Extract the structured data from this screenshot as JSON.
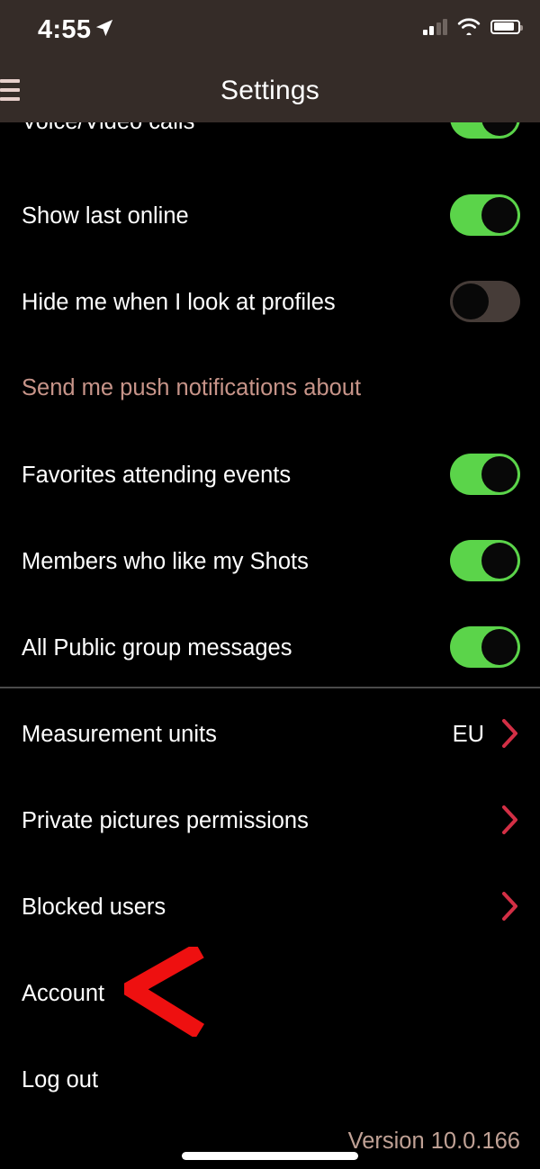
{
  "status_bar": {
    "time": "4:55",
    "location_icon": "location-arrow-icon",
    "cellular_icon": "cellular-signal-icon",
    "wifi_icon": "wifi-icon",
    "battery_icon": "battery-icon"
  },
  "nav": {
    "title": "Settings",
    "menu_icon": "hamburger-menu-icon",
    "logo_icon": "app-logo-hexagons-icon"
  },
  "colors": {
    "header_bg": "#352C28",
    "page_bg": "#000000",
    "toggle_on": "#5BD44A",
    "toggle_off": "#463C38",
    "chevron": "#D32F45",
    "section_header_text": "#C79489",
    "version_text": "#C0A195",
    "annotation_red": "#EE1010"
  },
  "privacy_section": {
    "rows": [
      {
        "label": "Voice/Video calls",
        "control": "toggle",
        "value": "on",
        "clipped": true
      },
      {
        "label": "Show last online",
        "control": "toggle",
        "value": "on"
      },
      {
        "label": "Hide me when I look at profiles",
        "control": "toggle",
        "value": "off"
      }
    ]
  },
  "notifications_section": {
    "header": "Send me push notifications about",
    "rows": [
      {
        "label": "Favorites attending events",
        "control": "toggle",
        "value": "on"
      },
      {
        "label": "Members who like my Shots",
        "control": "toggle",
        "value": "on"
      },
      {
        "label": "All Public group messages",
        "control": "toggle",
        "value": "on"
      }
    ]
  },
  "options_section": {
    "rows": [
      {
        "label": "Measurement units",
        "control": "chevron",
        "value": "EU"
      },
      {
        "label": "Private pictures permissions",
        "control": "chevron",
        "value": ""
      },
      {
        "label": "Blocked users",
        "control": "chevron",
        "value": ""
      },
      {
        "label": "Account",
        "control": "none",
        "value": ""
      },
      {
        "label": "Log out",
        "control": "none",
        "value": ""
      }
    ]
  },
  "footer": {
    "version": "Version 10.0.166"
  },
  "annotation": {
    "type": "left-pointing-chevron-arrow",
    "target": "Account"
  }
}
